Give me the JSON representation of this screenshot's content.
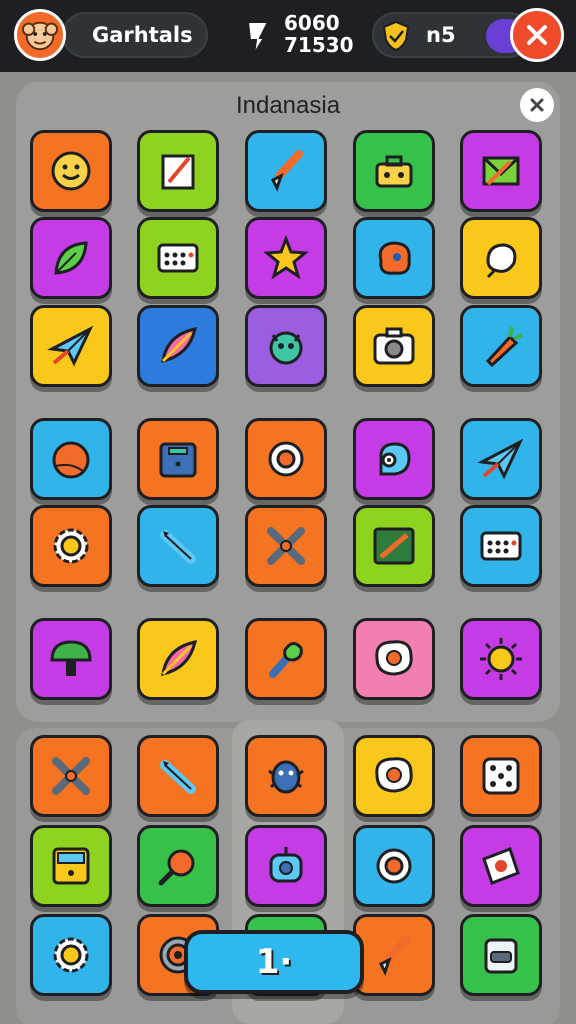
{
  "header": {
    "player_name": "Garhtals",
    "score_top": "6060",
    "score_bottom": "71530",
    "coins": "n5"
  },
  "panel": {
    "title": "Indanasia"
  },
  "level_button": {
    "label": "1·"
  },
  "colors": {
    "orange": "#f47421",
    "lime": "#8fd321",
    "sky": "#31b4ea",
    "magenta": "#c53ce6",
    "yellow": "#f9c81a",
    "green": "#36c24a",
    "blue": "#2e7bde",
    "purple": "#9b5ee0",
    "pink": "#f37fb0"
  },
  "tiles": [
    {
      "color": "orange",
      "icon": "smiley-face-icon"
    },
    {
      "color": "lime",
      "icon": "notebook-icon"
    },
    {
      "color": "sky",
      "icon": "paint-brush-icon"
    },
    {
      "color": "green",
      "icon": "toolbox-icon"
    },
    {
      "color": "magenta",
      "icon": "envelope-icon"
    },
    {
      "color": "magenta",
      "icon": "leaf-icon"
    },
    {
      "color": "lime",
      "icon": "keyboard-icon"
    },
    {
      "color": "magenta",
      "icon": "star-icon"
    },
    {
      "color": "sky",
      "icon": "blob-icon"
    },
    {
      "color": "yellow",
      "icon": "garlic-icon"
    },
    {
      "color": "yellow",
      "icon": "paper-plane-icon"
    },
    {
      "color": "blue",
      "icon": "feather-icon"
    },
    {
      "color": "purple",
      "icon": "monster-icon"
    },
    {
      "color": "yellow",
      "icon": "camera-icon"
    },
    {
      "color": "sky",
      "icon": "carrot-icon"
    },
    {
      "color": "sky",
      "icon": "ball-icon"
    },
    {
      "color": "orange",
      "icon": "treasure-box-icon"
    },
    {
      "color": "orange",
      "icon": "ring-icon"
    },
    {
      "color": "magenta",
      "icon": "snail-icon"
    },
    {
      "color": "sky",
      "icon": "paper-plane-icon"
    },
    {
      "color": "orange",
      "icon": "gear-icon"
    },
    {
      "color": "sky",
      "icon": "pencil-icon"
    },
    {
      "color": "orange",
      "icon": "crossed-tools-icon"
    },
    {
      "color": "lime",
      "icon": "chalkboard-icon"
    },
    {
      "color": "sky",
      "icon": "keyboard-icon"
    },
    {
      "color": "magenta",
      "icon": "mushroom-icon"
    },
    {
      "color": "yellow",
      "icon": "feather-icon"
    },
    {
      "color": "orange",
      "icon": "torch-icon"
    },
    {
      "color": "pink",
      "icon": "fried-egg-icon"
    },
    {
      "color": "magenta",
      "icon": "sun-icon"
    },
    {
      "color": "orange",
      "icon": "crossed-tools-icon"
    },
    {
      "color": "orange",
      "icon": "pencil-icon"
    },
    {
      "color": "orange",
      "icon": "bug-icon"
    },
    {
      "color": "yellow",
      "icon": "fried-egg-icon"
    },
    {
      "color": "orange",
      "icon": "dice-icon"
    },
    {
      "color": "lime",
      "icon": "chest-icon"
    },
    {
      "color": "green",
      "icon": "magnifier-icon"
    },
    {
      "color": "magenta",
      "icon": "robot-icon"
    },
    {
      "color": "sky",
      "icon": "ring-icon"
    },
    {
      "color": "magenta",
      "icon": "card-icon"
    },
    {
      "color": "sky",
      "icon": "gear-icon"
    },
    {
      "color": "orange",
      "icon": "target-icon"
    },
    {
      "color": "green",
      "icon": "blob-icon"
    },
    {
      "color": "orange",
      "icon": "paint-brush-icon"
    },
    {
      "color": "green",
      "icon": "radio-icon"
    }
  ]
}
